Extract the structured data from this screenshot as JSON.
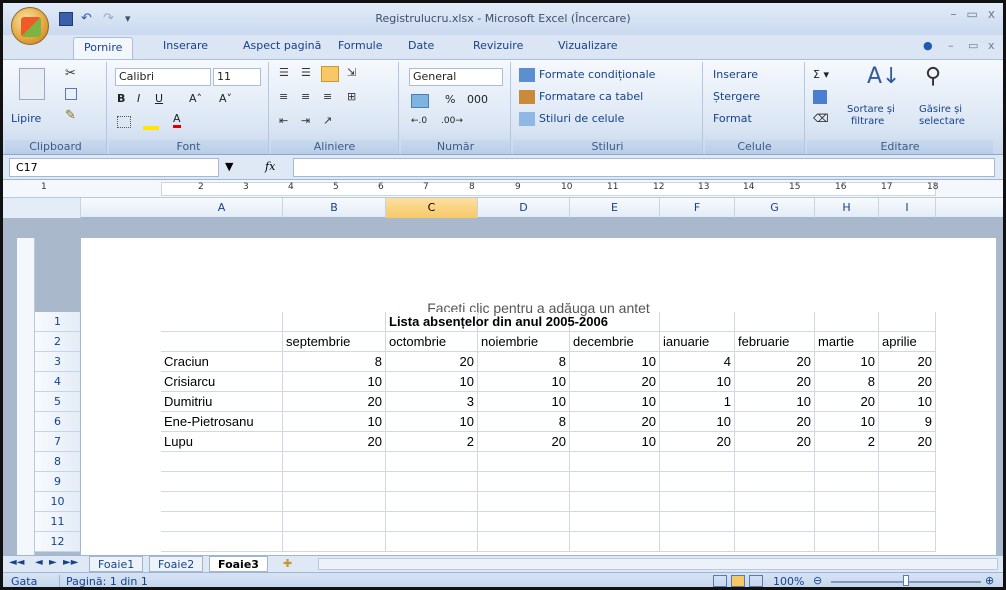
{
  "app": {
    "title": "Registrulucru.xlsx - Microsoft Excel (Încercare)"
  },
  "ribbon_tabs": [
    "Pornire",
    "Inserare",
    "Aspect pagină",
    "Formule",
    "Date",
    "Revizuire",
    "Vizualizare"
  ],
  "clipboard": {
    "paste": "Lipire",
    "label": "Clipboard"
  },
  "font": {
    "name": "Calibri",
    "size": "11",
    "label": "Font"
  },
  "alignment": {
    "label": "Aliniere"
  },
  "number": {
    "format": "General",
    "percent": "%",
    "thousands": "000",
    "label": "Număr"
  },
  "styles": {
    "conditional": "Formate condiționale",
    "table": "Formatare ca tabel",
    "cell": "Stiluri de celule",
    "label": "Stiluri"
  },
  "cells": {
    "insert": "Inserare",
    "delete": "Ștergere",
    "format": "Format",
    "label": "Celule"
  },
  "editing": {
    "sort": "Sortare și",
    "sort2": "filtrare",
    "find": "Găsire și",
    "find2": "selectare",
    "label": "Editare"
  },
  "formula_bar": {
    "name_box": "C17",
    "fx": "fx"
  },
  "ruler": [
    "1",
    "2",
    "3",
    "4",
    "5",
    "6",
    "7",
    "8",
    "9",
    "10",
    "11",
    "12",
    "13",
    "14",
    "15",
    "16",
    "17",
    "18"
  ],
  "columns": [
    "A",
    "B",
    "C",
    "D",
    "E",
    "F",
    "G",
    "H",
    "I"
  ],
  "selected_column": "C",
  "rows": [
    "1",
    "2",
    "3",
    "4",
    "5",
    "6",
    "7",
    "8",
    "9",
    "10",
    "11",
    "12"
  ],
  "page_header_hint": "Faceți clic pentru a adăuga un antet",
  "table": {
    "title": "Lista absențelor din anul 2005-2006",
    "months": [
      "septembrie",
      "octombrie",
      "noiembrie",
      "decembrie",
      "ianuarie",
      "februarie",
      "martie",
      "aprilie"
    ],
    "data": [
      {
        "name": "Craciun",
        "values": [
          "8",
          "20",
          "8",
          "10",
          "4",
          "20",
          "10",
          "20"
        ]
      },
      {
        "name": "Crisiarcu",
        "values": [
          "10",
          "10",
          "10",
          "20",
          "10",
          "20",
          "8",
          "20"
        ]
      },
      {
        "name": "Dumitriu",
        "values": [
          "20",
          "3",
          "10",
          "10",
          "1",
          "10",
          "20",
          "10"
        ]
      },
      {
        "name": "Ene-Pietrosanu",
        "values": [
          "10",
          "10",
          "8",
          "20",
          "10",
          "20",
          "10",
          "9"
        ]
      },
      {
        "name": "Lupu",
        "values": [
          "20",
          "2",
          "20",
          "10",
          "20",
          "20",
          "2",
          "20"
        ]
      }
    ]
  },
  "sheet_tabs": [
    "Foaie1",
    "Foaie2",
    "Foaie3"
  ],
  "active_sheet": "Foaie3",
  "status": {
    "mode": "Gata",
    "page": "Pagină: 1 din 1",
    "zoom": "100%"
  }
}
